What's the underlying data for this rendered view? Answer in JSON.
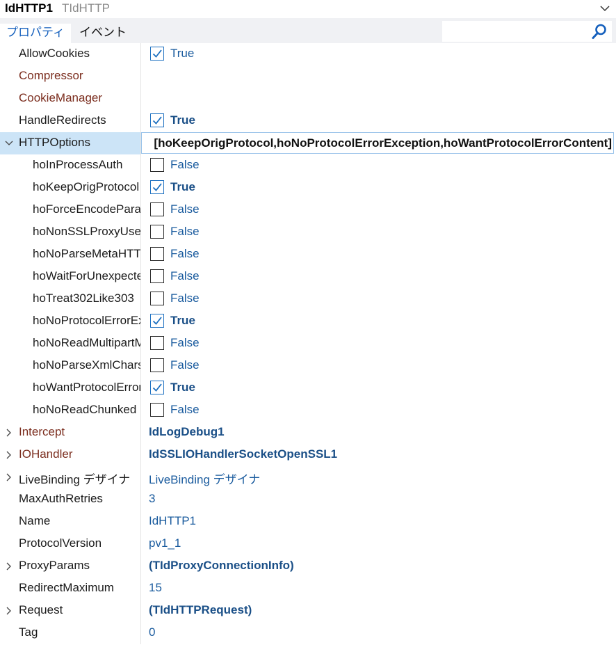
{
  "header": {
    "component_name": "IdHTTP1",
    "component_type": "TIdHTTP"
  },
  "tabs": [
    {
      "label": "プロパティ"
    },
    {
      "label": "イベント"
    }
  ],
  "search": {
    "placeholder": ""
  },
  "colors": {
    "accent": "#1560bd",
    "value_text": "#1a5b9e",
    "reference_property": "#7b2d1e",
    "selected_row": "#cce4f7",
    "tab_bar": "#f0f1f4"
  },
  "properties": [
    {
      "name": "AllowCookies",
      "value": "True",
      "checkbox": true,
      "checked": true,
      "bold": false
    },
    {
      "name": "Compressor",
      "value": "",
      "ref": true
    },
    {
      "name": "CookieManager",
      "value": "",
      "ref": true
    },
    {
      "name": "HandleRedirects",
      "value": "True",
      "checkbox": true,
      "checked": true,
      "bold": true
    },
    {
      "name": "HTTPOptions",
      "value": "[hoKeepOrigProtocol,hoNoProtocolErrorException,hoWantProtocolErrorContent]",
      "expanded": true,
      "selected": true,
      "editing": true
    },
    {
      "name": "hoInProcessAuth",
      "value": "False",
      "checkbox": true,
      "checked": false,
      "level": 1
    },
    {
      "name": "hoKeepOrigProtocol",
      "value": "True",
      "checkbox": true,
      "checked": true,
      "bold": true,
      "level": 1
    },
    {
      "name": "hoForceEncodeParams",
      "value": "False",
      "checkbox": true,
      "checked": false,
      "level": 1
    },
    {
      "name": "hoNonSSLProxyUseConnectVerb",
      "value": "False",
      "checkbox": true,
      "checked": false,
      "level": 1
    },
    {
      "name": "hoNoParseMetaHTTPEquiv",
      "value": "False",
      "checkbox": true,
      "checked": false,
      "level": 1
    },
    {
      "name": "hoWaitForUnexpectedData",
      "value": "False",
      "checkbox": true,
      "checked": false,
      "level": 1
    },
    {
      "name": "hoTreat302Like303",
      "value": "False",
      "checkbox": true,
      "checked": false,
      "level": 1
    },
    {
      "name": "hoNoProtocolErrorException",
      "value": "True",
      "checkbox": true,
      "checked": true,
      "bold": true,
      "level": 1
    },
    {
      "name": "hoNoReadMultipartMIME",
      "value": "False",
      "checkbox": true,
      "checked": false,
      "level": 1
    },
    {
      "name": "hoNoParseXmlCharset",
      "value": "False",
      "checkbox": true,
      "checked": false,
      "level": 1
    },
    {
      "name": "hoWantProtocolErrorContent",
      "value": "True",
      "checkbox": true,
      "checked": true,
      "bold": true,
      "level": 1
    },
    {
      "name": "hoNoReadChunked",
      "value": "False",
      "checkbox": true,
      "checked": false,
      "level": 1
    },
    {
      "name": "Intercept",
      "value": "IdLogDebug1",
      "ref": true,
      "collapsed": true,
      "bold": true
    },
    {
      "name": "IOHandler",
      "value": "IdSSLIOHandlerSocketOpenSSL1",
      "ref": true,
      "collapsed": true,
      "bold": true
    },
    {
      "name": "LiveBinding デザイナ",
      "value": "LiveBinding デザイナ",
      "collapsed": true
    },
    {
      "name": "MaxAuthRetries",
      "value": "3"
    },
    {
      "name": "Name",
      "value": "IdHTTP1"
    },
    {
      "name": "ProtocolVersion",
      "value": "pv1_1"
    },
    {
      "name": "ProxyParams",
      "value": "(TIdProxyConnectionInfo)",
      "collapsed": true,
      "bold": true
    },
    {
      "name": "RedirectMaximum",
      "value": "15"
    },
    {
      "name": "Request",
      "value": "(TIdHTTPRequest)",
      "collapsed": true,
      "bold": true
    },
    {
      "name": "Tag",
      "value": "0"
    }
  ]
}
